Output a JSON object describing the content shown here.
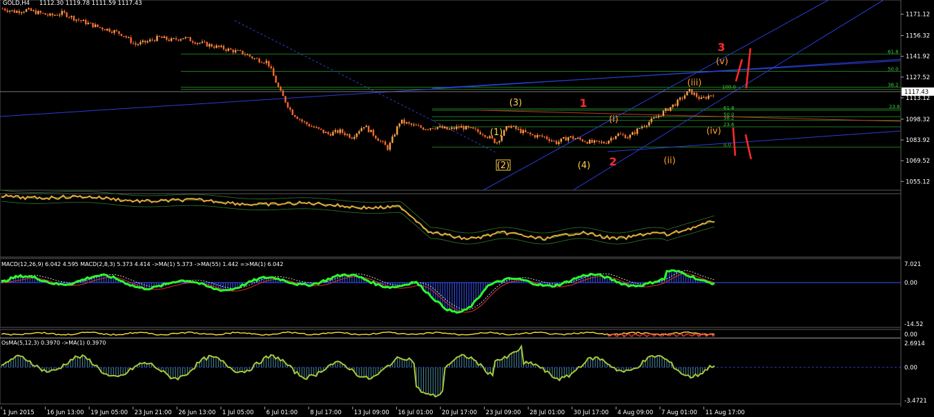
{
  "header": {
    "symbol": "GOLD,H4",
    "ohlc": "1112.30 1119.78 1111.59 1117.43"
  },
  "colors": {
    "background": "#000000",
    "bull_candle": "#ffa54c",
    "bear_candle": "#ff6a2a",
    "fib_line": "#1f7a1f",
    "trend_blue": "#2b3fd6",
    "red_line": "#c0392b",
    "wave_yellow": "#ffd24a",
    "wave_orange": "#ff9d2e",
    "wave_red": "#ff2a2a",
    "macd_green": "#2bff2b",
    "axis_text": "#ffffff"
  },
  "chart_data": [
    {
      "type": "candlestick",
      "name": "main",
      "ylim": [
        1050,
        1180
      ],
      "price_ticks": [
        "1171.12",
        "1156.32",
        "1141.92",
        "1127.52",
        "1113.12",
        "1098.32",
        "1083.92",
        "1069.52",
        "1055.12"
      ],
      "current_price_label": "1117.43",
      "x_labels": [
        "1 Jun 2015",
        "16 Jun 13:00",
        "19 Jun 05:00",
        "23 Jun 21:00",
        "26 Jun 13:00",
        "1 Jul 05:00",
        "6 Jul 01:00",
        "8 Jul 17:00",
        "13 Jul 09:00",
        "16 Jul 01:00",
        "20 Jul 17:00",
        "23 Jul 09:00",
        "28 Jul 01:00",
        "30 Jul 17:00",
        "4 Aug 09:00",
        "7 Aug 01:00",
        "11 Aug 17:00"
      ],
      "close_path": [
        1175,
        1173,
        1174,
        1172,
        1170,
        1172,
        1168,
        1165,
        1162,
        1160,
        1157,
        1150,
        1152,
        1155,
        1153,
        1155,
        1152,
        1150,
        1148,
        1146,
        1144,
        1140,
        1138,
        1118,
        1103,
        1096,
        1092,
        1088,
        1090,
        1086,
        1094,
        1086,
        1078,
        1097,
        1094,
        1092,
        1093,
        1091,
        1093,
        1091,
        1088,
        1082,
        1094,
        1090,
        1087,
        1086,
        1082,
        1086,
        1084,
        1082,
        1082,
        1088,
        1086,
        1093,
        1098,
        1104,
        1110,
        1118,
        1112,
        1116
      ],
      "fib_levels": [
        {
          "label": "61.8",
          "price": 1143.5
        },
        {
          "label": "50.0",
          "price": 1131.5
        },
        {
          "label": "38.2",
          "price": 1120.5
        },
        {
          "label": "100.0",
          "price": 1119.0
        },
        {
          "label": "23.6",
          "price": 1105.5
        },
        {
          "label": "61.8",
          "price": 1104.5
        },
        {
          "label": "50.0",
          "price": 1100.0
        },
        {
          "label": "38.2",
          "price": 1097.5
        },
        {
          "label": "23.6",
          "price": 1093.0
        },
        {
          "label": "0.0",
          "price": 1079.0
        }
      ],
      "wave_labels": [
        {
          "text": "(3)",
          "color": "yellow"
        },
        {
          "text": "(1)",
          "color": "yellow"
        },
        {
          "text": "(2)",
          "color": "yellow"
        },
        {
          "text": "(4)",
          "color": "yellow"
        },
        {
          "text": "1",
          "color": "red"
        },
        {
          "text": "2",
          "color": "red"
        },
        {
          "text": "3",
          "color": "red"
        },
        {
          "text": "(i)",
          "color": "orange"
        },
        {
          "text": "(ii)",
          "color": "orange"
        },
        {
          "text": "(iii)",
          "color": "orange"
        },
        {
          "text": "(iv)",
          "color": "orange"
        },
        {
          "text": "(v)",
          "color": "orange"
        }
      ]
    },
    {
      "type": "line",
      "name": "moving-average-panel"
    },
    {
      "type": "histogram",
      "name": "macd",
      "title": "MACD(12,26,9) 6.042 4.595  MACD(2,8,3) 5.373 4.414  ->MA(1) 5.373  ->MA(55) 1.442  =>MA(1) 6.042",
      "ticks": [
        "7.021",
        "0.00",
        "-14.52"
      ]
    },
    {
      "type": "line",
      "name": "oscillator-strip",
      "ticks": [
        "0.00"
      ]
    },
    {
      "type": "histogram",
      "name": "osma",
      "title": "OsMA(5,12,3) 0.3970  ->MA(1) 0.3970",
      "ticks": [
        "2.6914",
        "0.00",
        "-3.4721"
      ]
    }
  ]
}
